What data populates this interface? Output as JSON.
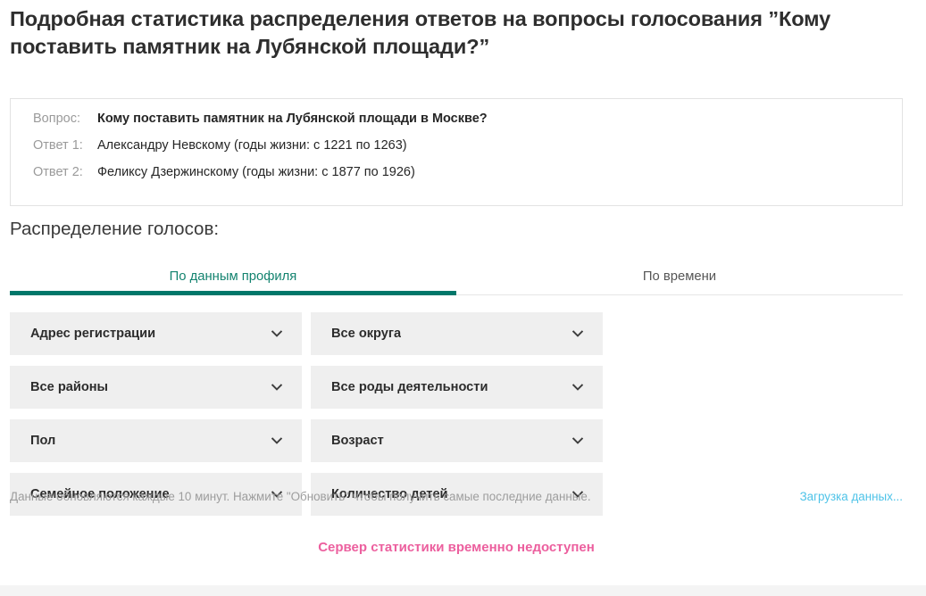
{
  "page": {
    "title": "Подробная статистика распределения ответов на вопросы голосования ”Кому поставить памятник на Лубянской площади?”"
  },
  "question_card": {
    "rows": [
      {
        "label": "Вопрос:",
        "value": "Кому поставить памятник на Лубянской площади в Москве?",
        "bold": true
      },
      {
        "label": "Ответ 1:",
        "value": "Александру Невскому (годы жизни: с 1221 по 1263)",
        "bold": false
      },
      {
        "label": "Ответ 2:",
        "value": "Феликсу Дзержинскому (годы жизни: с 1877 по 1926)",
        "bold": false
      }
    ]
  },
  "section": {
    "heading": "Распределение голосов:"
  },
  "tabs": [
    {
      "label": "По данным профиля",
      "active": true
    },
    {
      "label": "По времени",
      "active": false
    }
  ],
  "filters": [
    {
      "label": "Адрес регистрации",
      "icon": "chevron-down-icon",
      "name": "filter-registration-address"
    },
    {
      "label": "Все округа",
      "icon": "chevron-down-icon",
      "name": "filter-districts"
    },
    {
      "label": "Все районы",
      "icon": "chevron-down-icon",
      "name": "filter-regions"
    },
    {
      "label": "Все роды деятельности",
      "icon": "chevron-down-icon",
      "name": "filter-occupation"
    },
    {
      "label": "Пол",
      "icon": "chevron-down-icon",
      "name": "filter-gender"
    },
    {
      "label": "Возраст",
      "icon": "chevron-down-icon",
      "name": "filter-age"
    },
    {
      "label": "Семейное положение",
      "icon": "chevron-down-icon",
      "name": "filter-marital-status"
    },
    {
      "label": "Количество детей",
      "icon": "chevron-down-icon",
      "name": "filter-children-count"
    }
  ],
  "footer": {
    "note": "Данные обновляются каждые 10 минут. Нажмите \"Обновить\" чтобы получить самые последние данные.",
    "loading_link": "Загрузка данных..."
  },
  "status": {
    "message": "Сервер статистики временно недоступен"
  },
  "colors": {
    "tab_active": "#00776a",
    "tab_active_text": "#13836f",
    "loading_link": "#4ec3e8",
    "status_error": "#ec5f9e",
    "dropdown_bg": "#efefef",
    "card_border": "#e2e2e2"
  }
}
